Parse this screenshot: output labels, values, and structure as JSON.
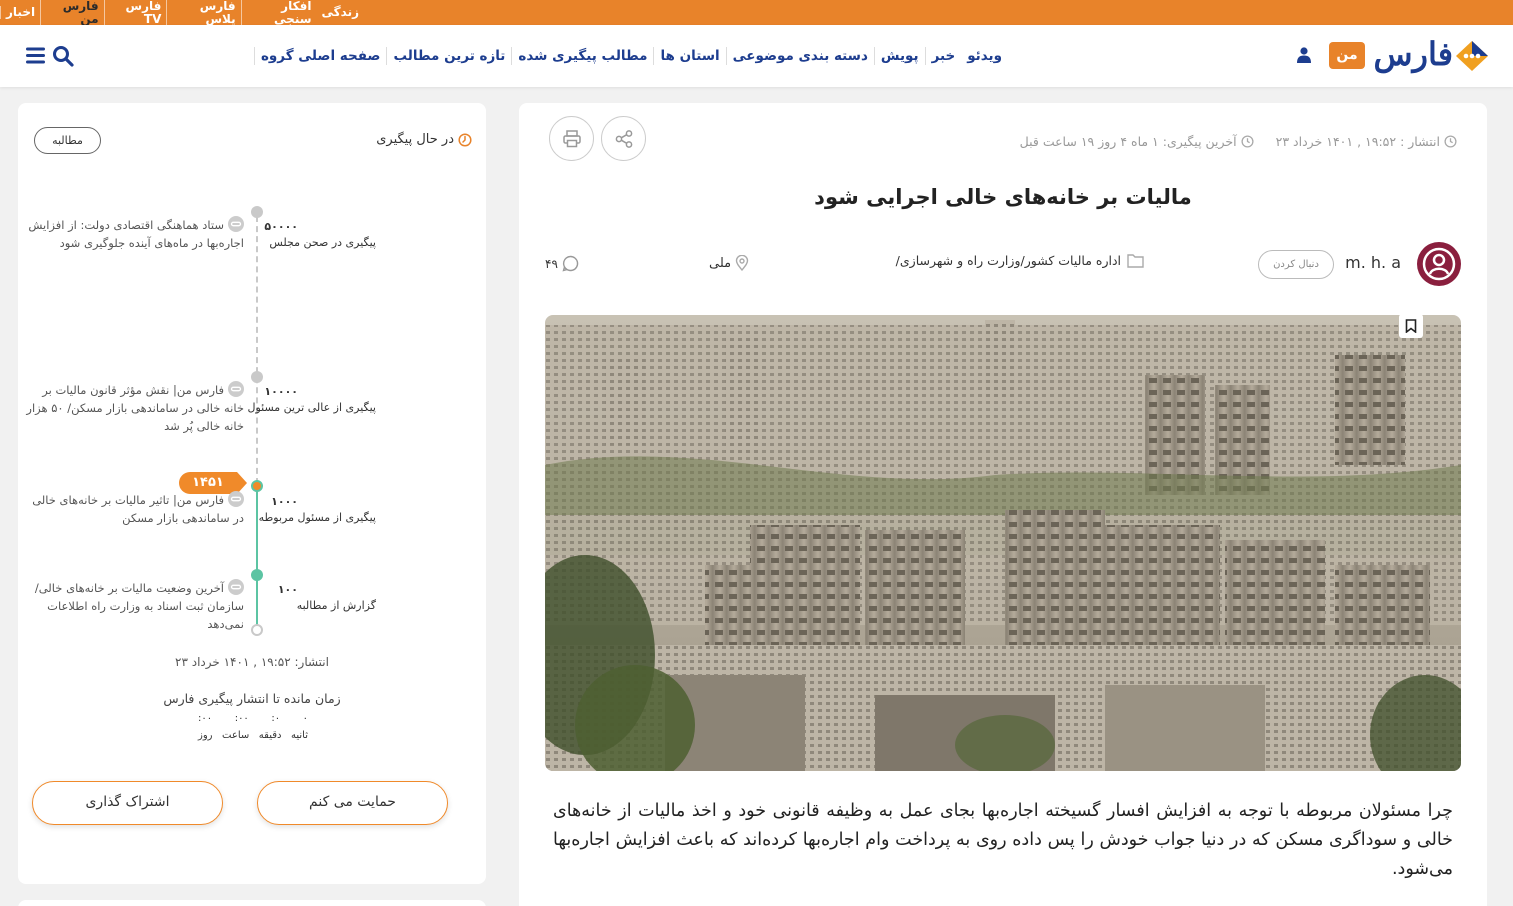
{
  "topbar": {
    "links": [
      "اخبار",
      "فارس من",
      "فارس TV",
      "فارس پلاس",
      "افکار سنجی",
      "زندگی"
    ]
  },
  "header": {
    "logo_text": "فارس",
    "man_badge": "من",
    "nav": [
      "صفحه اصلی گروه",
      "تازه ترین مطالب",
      "مطالب پیگیری شده",
      "استان ها",
      "دسته بندی موضوعی",
      "پویش",
      "خبر",
      "ویدئو"
    ]
  },
  "sidebar": {
    "status": "در حال پیگیری",
    "type_badge": "مطالبه",
    "steps": [
      {
        "num": "۵۰۰۰۰",
        "label": "پیگیری در صحن مجلس",
        "news": "ستاد هماهنگی اقتصادی دولت: از افزایش اجاره‌بها در ماه‌های آینده جلوگیری شود"
      },
      {
        "num": "۱۰۰۰۰",
        "label": "پیگیری از عالی ترین مسئول",
        "news": "فارس من| نقش مؤثر قانون مالیات بر خانه خالی در ساماندهی بازار مسکن/ ۵۰ هزار خانه خالی پُر شد"
      },
      {
        "num": "۱۰۰۰",
        "label": "پیگیری از مسئول مربوطه",
        "news": "فارس من| تاثیر مالیات بر خانه‌های خالی در ساماندهی بازار مسکن"
      },
      {
        "num": "۱۰۰",
        "label": "گزارش از مطالبه",
        "news": "آخرین وضعیت مالیات بر خانه‌های خالی/ سازمان ثبت اسناد به وزارت راه اطلاعات نمی‌دهد"
      }
    ],
    "year_tag": "۱۴۵۱",
    "published": "انتشار: ۱۹:۵۲ , ۱۴۰۱ خرداد ۲۳",
    "remaining_title": "زمان مانده تا انتشار پیگیری فارس",
    "countdown": {
      "values": [
        "۰۰:",
        "۰۰:",
        "۰:",
        "۰"
      ],
      "labels": [
        "روز",
        "ساعت",
        "دقیقه",
        "ثانیه"
      ]
    },
    "support_button": "حمایت می کنم",
    "share_button": "اشتراک گذاری"
  },
  "article": {
    "published": "انتشار : ۱۹:۵۲ , ۱۴۰۱ خرداد ۲۳",
    "last_followup": "آخرین پیگیری: ۱ ماه ۴ روز ۱۹ ساعت قبل",
    "title": "مالیات بر خانه‌های خالی اجرایی شود",
    "author": "m. h. a",
    "follow_button": "دنبال کردن",
    "category": "اداره مالیات کشور/وزارت راه و شهرسازی/",
    "location": "ملی",
    "comments": "۴۹",
    "lead": "چرا مسئولان مربوطه با توجه به افزایش افسار گسیخته اجاره‌بها بجای عمل به وظیفه قانونی خود و اخذ مالیات از خانه‌های خالی و سوداگری مسکن که در دنیا جواب خودش را پس داده روی به پرداخت وام اجاره‌بها کرده‌اند که باعث افزایش اجاره‌بها می‌شود."
  },
  "colors": {
    "brand_orange": "#e8832a",
    "brand_blue": "#1d3d8f",
    "timeline_green": "#5cc4a3"
  }
}
